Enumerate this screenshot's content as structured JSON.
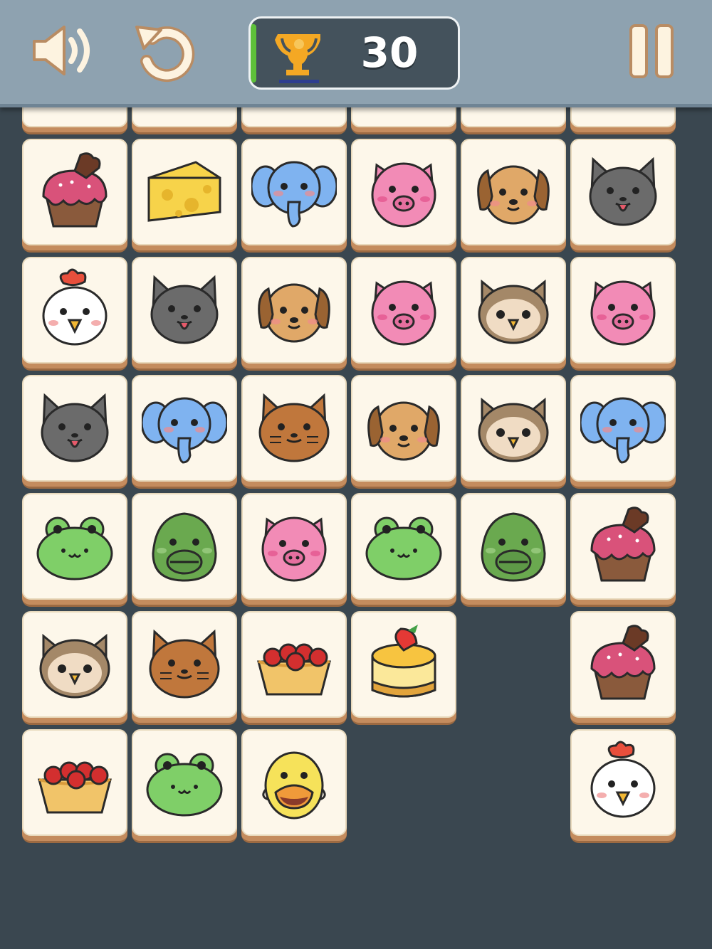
{
  "header": {
    "score": "30",
    "sound_icon": "speaker-icon",
    "undo_icon": "undo-icon",
    "pause_icon": "pause-icon",
    "trophy_icon": "trophy-icon"
  },
  "board": {
    "top_row_partial": 6,
    "rows": [
      [
        "cupcake",
        "cheese",
        "elephant",
        "pig",
        "dog",
        "cat-gray"
      ],
      [
        "chicken",
        "cat-gray",
        "dog",
        "pig",
        "owl",
        "pig"
      ],
      [
        "cat-gray",
        "elephant",
        "cat-orange",
        "dog",
        "owl",
        "elephant"
      ],
      [
        "frog",
        "turtle",
        "pig",
        "frog",
        "turtle",
        "cupcake"
      ],
      [
        "owl",
        "cat-orange",
        "tart",
        "cheesecake",
        null,
        "cupcake"
      ],
      [
        "tart",
        "frog",
        "duck",
        null,
        null,
        "chicken"
      ]
    ]
  },
  "colors": {
    "background": "#3a4750",
    "header": "#8ea2b0",
    "tile_face": "#fdf7ea",
    "tile_side": "#c48c5e",
    "score_panel": "#44525c",
    "accent_green": "#5ec13a"
  }
}
